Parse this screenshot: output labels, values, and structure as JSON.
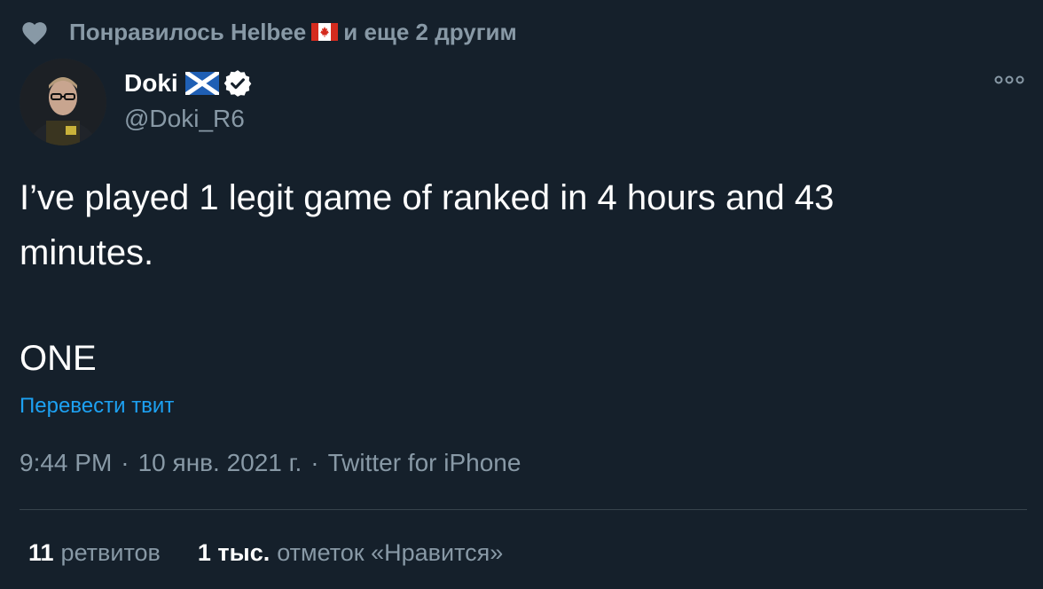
{
  "liked_by": {
    "prefix": "Понравилось Helbee",
    "suffix": "и еще 2 другим",
    "flag_icon": "canada-flag-icon"
  },
  "author": {
    "name": "Doki",
    "handle": "@Doki_R6",
    "flag_icon": "scotland-flag-icon",
    "verified": true
  },
  "tweet": {
    "text_line1": "I’ve played 1 legit game of ranked in 4 hours and 43\nminutes.",
    "text_line2": "ONE",
    "translate_label": "Перевести твит"
  },
  "meta": {
    "time": "9:44 PM",
    "date": "10 янв. 2021 г.",
    "source": "Twitter for iPhone",
    "separator": "·"
  },
  "stats": {
    "retweets_count": "11",
    "retweets_label": "ретвитов",
    "likes_count": "1 тыс.",
    "likes_label": "отметок «Нравится»"
  },
  "colors": {
    "background": "#15202b",
    "secondary_text": "#8899a6",
    "link": "#1da1f2",
    "divider": "#38444d"
  }
}
